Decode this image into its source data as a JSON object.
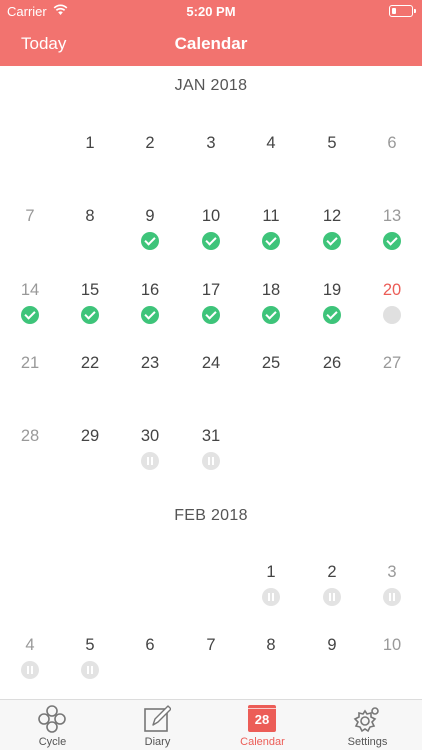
{
  "status_bar": {
    "carrier": "Carrier",
    "time": "5:20 PM"
  },
  "nav": {
    "left_button": "Today",
    "title": "Calendar"
  },
  "months": [
    {
      "title": "JAN 2018",
      "days": [
        {
          "day": "1",
          "status": "none"
        },
        {
          "day": "2",
          "status": "none"
        },
        {
          "day": "3",
          "status": "none"
        },
        {
          "day": "4",
          "status": "none"
        },
        {
          "day": "5",
          "status": "none"
        },
        {
          "day": "6",
          "status": "none"
        },
        {
          "day": "7",
          "status": "none"
        },
        {
          "day": "8",
          "status": "none"
        },
        {
          "day": "9",
          "status": "done"
        },
        {
          "day": "10",
          "status": "done"
        },
        {
          "day": "11",
          "status": "done"
        },
        {
          "day": "12",
          "status": "done"
        },
        {
          "day": "13",
          "status": "done"
        },
        {
          "day": "14",
          "status": "done"
        },
        {
          "day": "15",
          "status": "done"
        },
        {
          "day": "16",
          "status": "done"
        },
        {
          "day": "17",
          "status": "done"
        },
        {
          "day": "18",
          "status": "done"
        },
        {
          "day": "19",
          "status": "done"
        },
        {
          "day": "20",
          "status": "empty",
          "today": true
        },
        {
          "day": "21",
          "status": "none"
        },
        {
          "day": "22",
          "status": "none"
        },
        {
          "day": "23",
          "status": "none"
        },
        {
          "day": "24",
          "status": "none"
        },
        {
          "day": "25",
          "status": "none"
        },
        {
          "day": "26",
          "status": "none"
        },
        {
          "day": "27",
          "status": "none"
        },
        {
          "day": "28",
          "status": "none"
        },
        {
          "day": "29",
          "status": "none"
        },
        {
          "day": "30",
          "status": "paused"
        },
        {
          "day": "31",
          "status": "paused"
        }
      ]
    },
    {
      "title": "FEB 2018",
      "days": [
        {
          "day": "1",
          "status": "paused"
        },
        {
          "day": "2",
          "status": "paused"
        },
        {
          "day": "3",
          "status": "paused"
        },
        {
          "day": "4",
          "status": "paused"
        },
        {
          "day": "5",
          "status": "paused"
        },
        {
          "day": "6",
          "status": "none"
        },
        {
          "day": "7",
          "status": "none"
        },
        {
          "day": "8",
          "status": "none"
        },
        {
          "day": "9",
          "status": "none"
        },
        {
          "day": "10",
          "status": "none"
        }
      ]
    }
  ],
  "tabs": [
    {
      "label": "Cycle",
      "icon": "cycle-icon",
      "active": false
    },
    {
      "label": "Diary",
      "icon": "diary-icon",
      "active": false
    },
    {
      "label": "Calendar",
      "icon": "calendar-icon",
      "active": true,
      "badge": "28"
    },
    {
      "label": "Settings",
      "icon": "settings-icon",
      "active": false
    }
  ],
  "colors": {
    "accent": "#f2736f",
    "done": "#3ec47a",
    "today": "#ec5d57"
  }
}
